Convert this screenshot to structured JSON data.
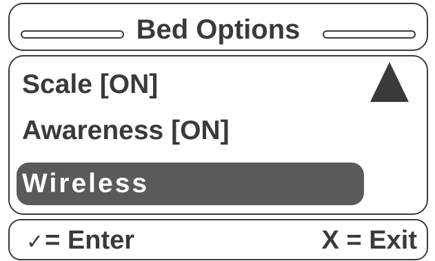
{
  "header": {
    "title": "Bed Options"
  },
  "menu": {
    "items": [
      {
        "label": "Scale [ON]"
      },
      {
        "label": "Awareness [ON]"
      },
      {
        "label": "Wireless",
        "selected": true
      }
    ],
    "scroll_icon": "triangle-up-icon"
  },
  "footer": {
    "enter_icon": "check-icon",
    "enter_symbol": "✓",
    "enter_label": "= Enter",
    "exit_label": "X = Exit"
  },
  "colors": {
    "foreground": "#3a3a3a",
    "selected_bg": "#5a5a5a",
    "selected_text": "#ffffff",
    "background": "#ffffff"
  }
}
